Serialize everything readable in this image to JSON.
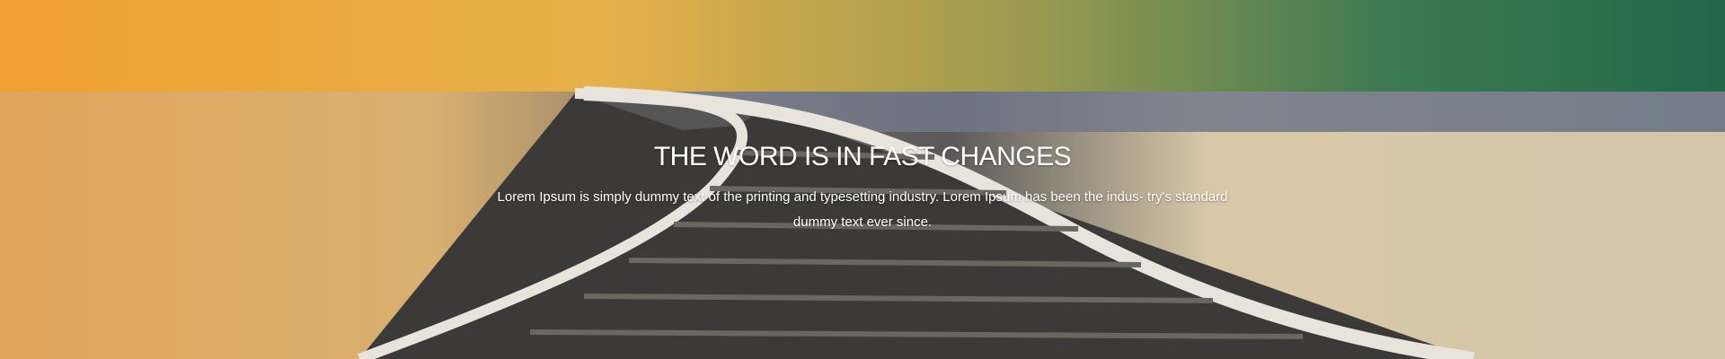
{
  "hero": {
    "title": "THE WORD IS IN FAST CHANGES",
    "description": "Lorem Ipsum is simply dummy text of the printing and typesetting industry. Lorem Ipsum has been the indus- try's standard dummy text ever since."
  }
}
